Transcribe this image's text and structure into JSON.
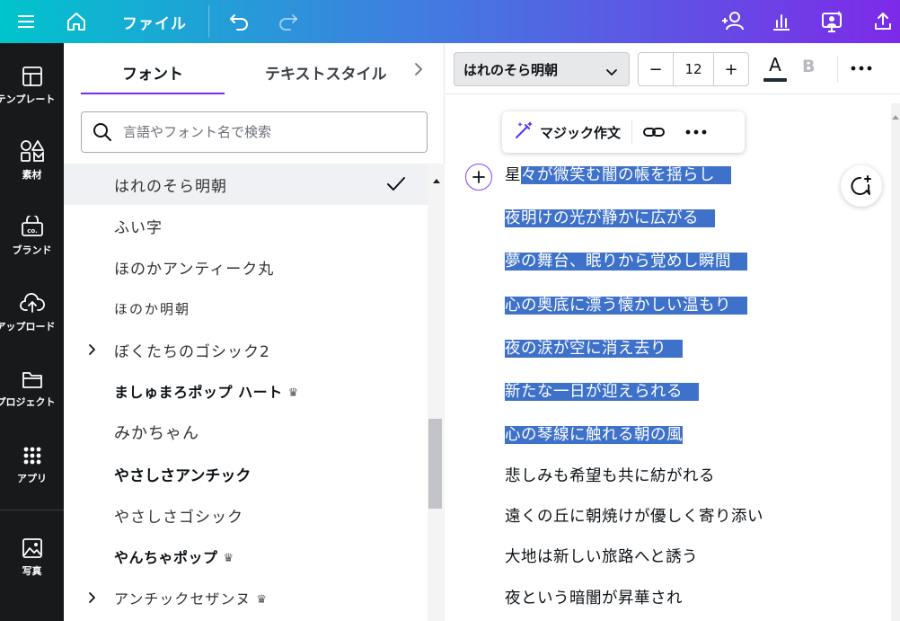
{
  "topbar": {
    "menu_icon": "hamburger-icon",
    "home_icon": "home-icon",
    "file_label": "ファイル",
    "undo_icon": "undo-icon",
    "redo_icon": "redo-icon",
    "right_icons": [
      "add-collaborator-icon",
      "insights-icon",
      "present-icon",
      "share-upload-icon"
    ]
  },
  "rail": {
    "items": [
      {
        "label": "テンプレート",
        "icon": "template-icon"
      },
      {
        "label": "素材",
        "icon": "elements-icon"
      },
      {
        "label": "ブランド",
        "icon": "brand-icon"
      },
      {
        "label": "アップロード",
        "icon": "upload-icon"
      },
      {
        "label": "プロジェクト",
        "icon": "folder-icon"
      },
      {
        "label": "アプリ",
        "icon": "apps-icon"
      },
      {
        "label": "写真",
        "icon": "photo-icon"
      }
    ]
  },
  "panel": {
    "tabs": [
      {
        "label": "フォント",
        "active": true
      },
      {
        "label": "テキストスタイル",
        "active": false
      }
    ],
    "search_placeholder": "言語やフォント名で検索",
    "fonts": [
      {
        "name": "はれのそら明朝",
        "selected": true,
        "expandable": false,
        "premium": false
      },
      {
        "name": "ふい字",
        "selected": false,
        "expandable": false,
        "premium": false
      },
      {
        "name": "ほのかアンティーク丸",
        "selected": false,
        "expandable": false,
        "premium": false
      },
      {
        "name": "ほのか明朝",
        "selected": false,
        "expandable": false,
        "premium": false
      },
      {
        "name": "ぼくたちのゴシック2",
        "selected": false,
        "expandable": true,
        "premium": false
      },
      {
        "name": "ましゅまろポップ ハート",
        "selected": false,
        "expandable": false,
        "premium": true
      },
      {
        "name": "みかちゃん",
        "selected": false,
        "expandable": false,
        "premium": false
      },
      {
        "name": "やさしさアンチック",
        "selected": false,
        "expandable": false,
        "premium": false
      },
      {
        "name": "やさしさゴシック",
        "selected": false,
        "expandable": false,
        "premium": false
      },
      {
        "name": "やんちゃポップ",
        "selected": false,
        "expandable": false,
        "premium": true
      },
      {
        "name": "アンチックセザンヌ",
        "selected": false,
        "expandable": true,
        "premium": true
      }
    ]
  },
  "toolbar": {
    "font_name": "はれのそら明朝",
    "font_size": "12",
    "minus_label": "−",
    "plus_label": "+",
    "text_color_label": "A",
    "bold_label": "B",
    "text_color": "#1e2a38"
  },
  "floating_toolbar": {
    "magic_label": "マジック作文"
  },
  "poem": {
    "lines": [
      {
        "first": "星",
        "rest": "々が微笑む闇の帳を揺らし",
        "highlighted": true
      },
      {
        "first": "",
        "rest": "夜明けの光が静かに広がる",
        "highlighted": true
      },
      {
        "first": "",
        "rest": "夢の舞台、眠りから覚めし瞬間",
        "highlighted": true
      },
      {
        "first": "",
        "rest": "心の奥底に漂う懐かしい温もり",
        "highlighted": true
      },
      {
        "first": "",
        "rest": "夜の涙が空に消え去り",
        "highlighted": true
      },
      {
        "first": "",
        "rest": "新たな一日が迎えられる",
        "highlighted": true
      },
      {
        "first": "",
        "rest": "心の琴線に触れる朝の風",
        "highlighted": true
      },
      {
        "first": "",
        "rest": "悲しみも希望も共に紡がれる",
        "highlighted": false
      },
      {
        "first": "",
        "rest": "遠くの丘に朝焼けが優しく寄り添い",
        "highlighted": false
      },
      {
        "first": "",
        "rest": "大地は新しい旅路へと誘う",
        "highlighted": false
      },
      {
        "first": "",
        "rest": "夜という暗闇が昇華され",
        "highlighted": false
      }
    ]
  },
  "colors": {
    "selection": "#3e71c9",
    "accent": "#7d2ae8",
    "rail_bg": "#18191b"
  }
}
